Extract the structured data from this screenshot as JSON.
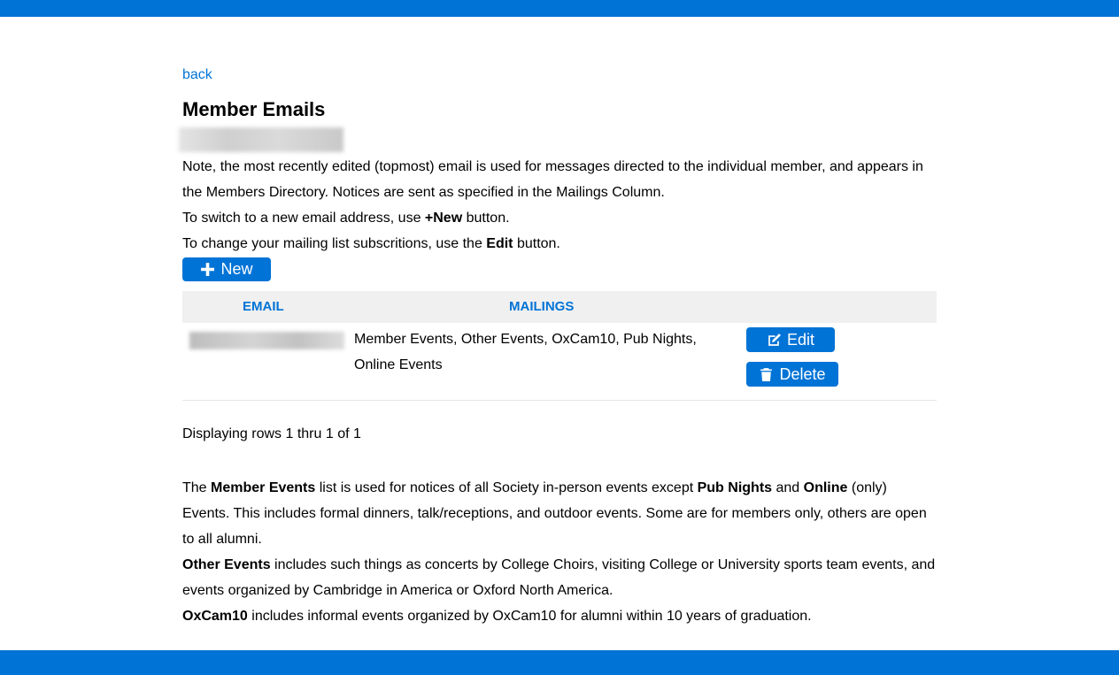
{
  "nav": {
    "back_label": "back"
  },
  "page": {
    "title": "Member Emails"
  },
  "note": {
    "line1": "Note, the most recently edited (topmost) email is used for messages directed to the individual member, and appears in the Members Directory. Notices are sent as specified in the Mailings Column.",
    "line2_pre": "To switch to a new email address, use ",
    "line2_bold": "+New",
    "line2_post": " button.",
    "line3_pre": "To change your mailing list subscritions, use the ",
    "line3_bold": "Edit",
    "line3_post": " button."
  },
  "buttons": {
    "new_label": "New",
    "edit_label": "Edit",
    "delete_label": "Delete"
  },
  "table": {
    "headers": {
      "email": "EMAIL",
      "mailings": "MAILINGS"
    },
    "rows": [
      {
        "mailings": "Member Events, Other Events, OxCam10, Pub Nights, Online Events"
      }
    ],
    "status": "Displaying rows 1 thru 1 of 1"
  },
  "description": {
    "p1": {
      "t1": "The ",
      "b1": "Member Events",
      "t2": " list is used for notices of all Society in-person events except ",
      "b2": "Pub Nights",
      "t3": " and ",
      "b3": "Online",
      "t4": " (only) Events. This includes formal dinners, talk/receptions, and outdoor events. Some are for members only, others are open to all alumni."
    },
    "p2": {
      "b1": "Other Events",
      "t1": " includes such things as concerts by College Choirs, visiting College or University sports team events, and events organized by Cambridge in America or Oxford North America."
    },
    "p3": {
      "b1": "OxCam10",
      "t1": " includes informal events organized by OxCam10 for alumni within 10 years of graduation."
    }
  },
  "icons": {
    "new": "plus-icon",
    "edit": "edit-icon",
    "delete": "trash-icon"
  },
  "colors": {
    "accent": "#0073d6",
    "header_bg": "#f0f0f0"
  }
}
